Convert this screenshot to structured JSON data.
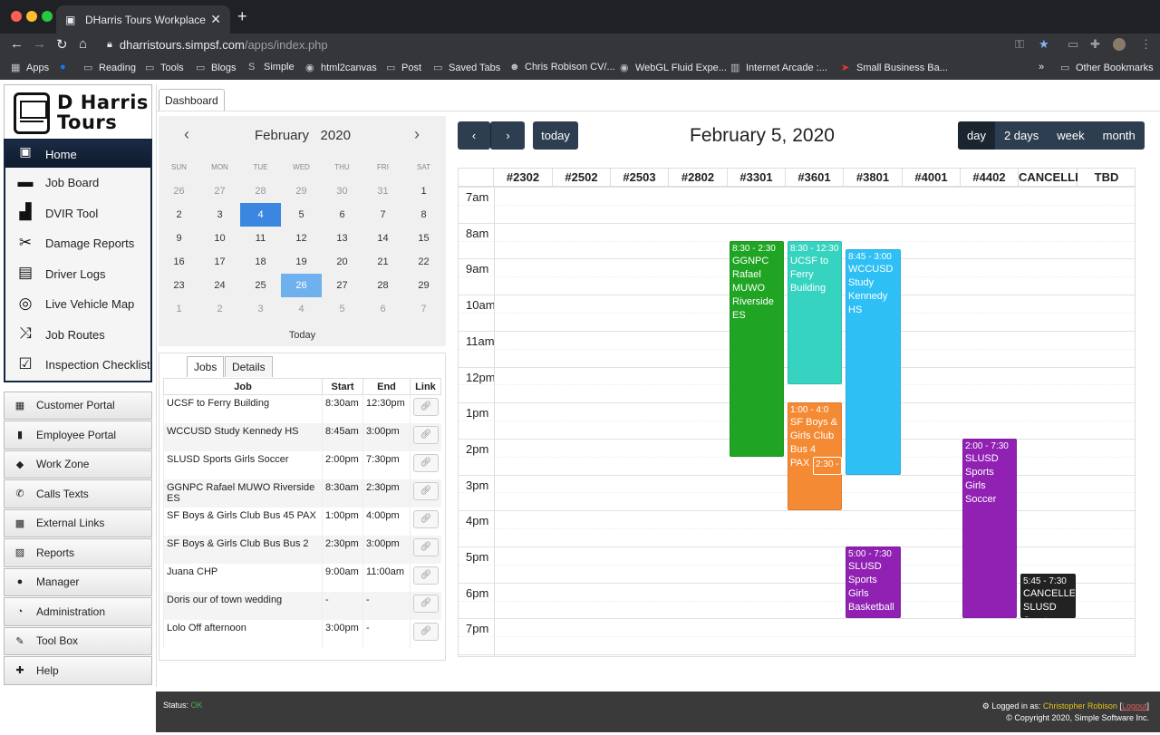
{
  "browser": {
    "tab_title": "DHarris Tours Workplace",
    "url_host": "dharristours.simpsf.com",
    "url_path": "/apps/index.php",
    "bookmarks": [
      "Apps",
      "Reading",
      "Tools",
      "Blogs",
      "Simple",
      "html2canvas",
      "Post",
      "Saved Tabs",
      "Chris Robison CV/...",
      "WebGL Fluid Expe...",
      "Internet Arcade :...",
      "Small Business Ba..."
    ],
    "other_bookmarks": "Other Bookmarks",
    "more": "»"
  },
  "logo": {
    "line1": "D Harris",
    "line2": "Tours"
  },
  "nav": {
    "home": "Home",
    "items": [
      "Job Board",
      "DVIR Tool",
      "Damage Reports",
      "Driver Logs",
      "Live Vehicle Map",
      "Job Routes",
      "Inspection Checklist"
    ]
  },
  "sections": [
    "Customer Portal",
    "Employee Portal",
    "Work Zone",
    "Calls Texts",
    "External Links",
    "Reports",
    "Manager",
    "Administration",
    "Tool Box",
    "Help"
  ],
  "dashboard_tab": "Dashboard",
  "minical": {
    "month": "February",
    "year": "2020",
    "dow": [
      "SUN",
      "MON",
      "TUE",
      "WED",
      "THU",
      "FRI",
      "SAT"
    ],
    "weeks": [
      [
        "26",
        "27",
        "28",
        "29",
        "30",
        "31",
        "1"
      ],
      [
        "2",
        "3",
        "4",
        "5",
        "6",
        "7",
        "8"
      ],
      [
        "9",
        "10",
        "11",
        "12",
        "13",
        "14",
        "15"
      ],
      [
        "16",
        "17",
        "18",
        "19",
        "20",
        "21",
        "22"
      ],
      [
        "23",
        "24",
        "25",
        "26",
        "27",
        "28",
        "29"
      ],
      [
        "1",
        "2",
        "3",
        "4",
        "5",
        "6",
        "7"
      ]
    ],
    "today_label": "Today",
    "selected_day": "4",
    "highlighted_day": "26"
  },
  "jobs_panel": {
    "tabs": [
      "Jobs",
      "Details"
    ],
    "headers": [
      "Job",
      "Start",
      "End",
      "Link"
    ],
    "rows": [
      {
        "job": "UCSF to Ferry Building",
        "start": "8:30am",
        "end": "12:30pm"
      },
      {
        "job": "WCCUSD Study Kennedy HS",
        "start": "8:45am",
        "end": "3:00pm"
      },
      {
        "job": "SLUSD Sports Girls Soccer",
        "start": "2:00pm",
        "end": "7:30pm"
      },
      {
        "job": "GGNPC Rafael MUWO Riverside ES",
        "start": "8:30am",
        "end": "2:30pm"
      },
      {
        "job": "SF Boys & Girls Club Bus 45 PAX",
        "start": "1:00pm",
        "end": "4:00pm"
      },
      {
        "job": "SF Boys & Girls Club Bus Bus 2",
        "start": "2:30pm",
        "end": "3:00pm"
      },
      {
        "job": "Juana CHP",
        "start": "9:00am",
        "end": "11:00am"
      },
      {
        "job": "Doris our of town wedding",
        "start": "-",
        "end": "-"
      },
      {
        "job": "Lolo Off afternoon",
        "start": "3:00pm",
        "end": "-"
      }
    ]
  },
  "calendar": {
    "title": "February 5, 2020",
    "today_btn": "today",
    "prev_icon": "chevron-left",
    "next_icon": "chevron-right",
    "views": [
      "day",
      "2 days",
      "week",
      "month"
    ],
    "active_view": "day",
    "resources": [
      "#2302",
      "#2502",
      "#2503",
      "#2802",
      "#3301",
      "#3601",
      "#3801",
      "#4001",
      "#4402",
      "CANCELLED",
      "TBD"
    ],
    "hours": [
      "7am",
      "8am",
      "9am",
      "10am",
      "11am",
      "12pm",
      "1pm",
      "2pm",
      "3pm",
      "4pm",
      "5pm",
      "6pm",
      "7pm"
    ],
    "events": [
      {
        "res": 4,
        "start": 8.5,
        "end": 14.5,
        "time": "8:30 - 2:30",
        "title": "GGNPC Rafael MUWO Riverside ES",
        "color": "#1fa523"
      },
      {
        "res": 5,
        "start": 8.5,
        "end": 12.5,
        "time": "8:30 - 12:30",
        "title": "UCSF to Ferry Building",
        "color": "#35d3c0"
      },
      {
        "res": 6,
        "start": 8.75,
        "end": 15.0,
        "time": "8:45 - 3:00",
        "title": "WCCUSD Study Kennedy HS",
        "color": "#2ec0f5"
      },
      {
        "res": 5,
        "start": 13.0,
        "end": 16.0,
        "time": "1:00 - 4:0",
        "title": "SF Boys & Girls Club Bus 4",
        "extra": "PAX",
        "color": "#f58a35"
      },
      {
        "res": 8,
        "start": 14.0,
        "end": 19.0,
        "time": "2:00 - 7:30",
        "title": "SLUSD Sports Girls Soccer",
        "color": "#9021b3"
      },
      {
        "res": 6,
        "start": 17.0,
        "end": 19.0,
        "time": "5:00 - 7:30",
        "title": "SLUSD Sports Girls Basketball",
        "color": "#9021b3"
      },
      {
        "res": 9,
        "start": 17.75,
        "end": 19.0,
        "time": "5:45 - 7:30",
        "title": "CANCELLED SLUSD Sports Girls",
        "color": "#222222"
      }
    ],
    "small_event": {
      "time": "2:30 -",
      "color": "#f58a35"
    }
  },
  "footer": {
    "status_label": "Status:",
    "status": "OK",
    "logged_in": "Logged in as:",
    "user": "Christopher Robison",
    "logout": "Logout",
    "copyright": "© Copyright 2020, Simple Software Inc."
  }
}
